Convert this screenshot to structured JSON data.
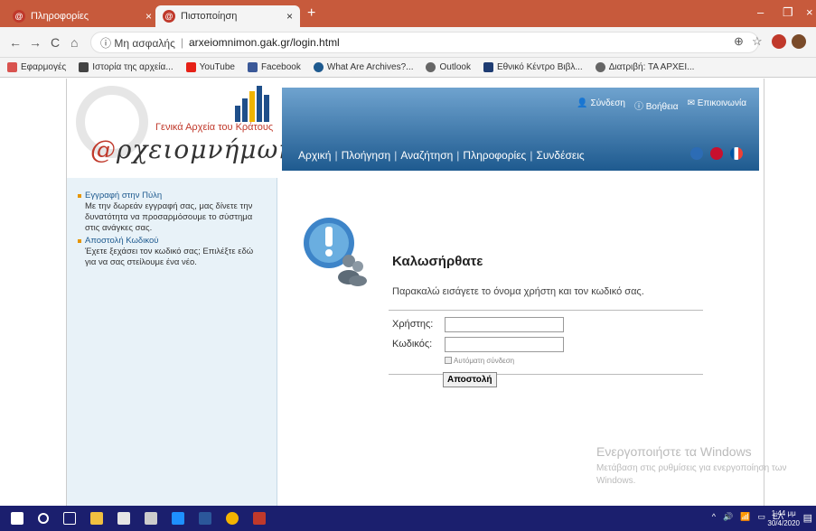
{
  "browser": {
    "tabs": [
      {
        "title": "Πληροφορίες",
        "active": false
      },
      {
        "title": "Πιστοποίηση",
        "active": true
      }
    ],
    "new_tab": "+",
    "address": {
      "security": "ⓘ Μη ασφαλής",
      "url": "arxeiomnimon.gak.gr/login.html"
    },
    "bookmarks": [
      {
        "label": "Εφαρμογές",
        "color": "#d9534f"
      },
      {
        "label": "Ιστορία της αρχεία...",
        "color": "#444"
      },
      {
        "label": "YouTube",
        "color": "#e62117"
      },
      {
        "label": "Facebook",
        "color": "#3b5998"
      },
      {
        "label": "What Are Archives?...",
        "color": "#1e5a8f"
      },
      {
        "label": "Outlook",
        "color": "#666"
      },
      {
        "label": "Εθνικό Κέντρο Βιβλ...",
        "color": "#1e3c72"
      },
      {
        "label": "Διατριβή: ΤΑ ΑΡΧΕΙ...",
        "color": "#666"
      }
    ]
  },
  "site": {
    "org_name": "Γενικά Αρχεία του Κράτους",
    "logo_prefix": "@",
    "logo_text": "ρχειομνήμων",
    "top_links": [
      {
        "label": "Σύνδεση"
      },
      {
        "label": "Βοήθεια"
      },
      {
        "label": "Επικοινωνία"
      }
    ],
    "menu": [
      "Αρχική",
      "Πλοήγηση",
      "Αναζήτηση",
      "Πληροφορίες",
      "Συνδέσεις"
    ],
    "menu_sep": "|",
    "sidebar": [
      {
        "title": "Εγγραφή στην Πύλη",
        "desc": "Με την δωρεάν εγγραφή σας, μας δίνετε την δυνατότητα να προσαρμόσουμε το σύστημα στις ανάγκες σας."
      },
      {
        "title": "Αποστολή Κωδικού",
        "desc": "Έχετε ξεχάσει τον κωδικό σας; Επιλέξτε εδώ για να σας στείλουμε ένα νέο."
      }
    ]
  },
  "login": {
    "welcome": "Καλωσήρθατε",
    "prompt": "Παρακαλώ εισάγετε το όνομα χρήστη και τον κωδικό σας.",
    "username_label": "Χρήστης:",
    "password_label": "Κωδικός:",
    "auto_login": "Αυτόματη σύνδεση",
    "submit": "Αποστολή",
    "username_value": "",
    "password_value": ""
  },
  "watermark": {
    "line1": "Ενεργοποιήστε τα Windows",
    "line2": "Μετάβαση στις ρυθμίσεις για ενεργοποίηση των Windows."
  },
  "taskbar": {
    "lang": "ΕΛ",
    "time": "1:44 μμ",
    "date": "30/4/2020"
  },
  "colors": {
    "titlebar": "#c75a3c",
    "banner_top": "#6fa3cf",
    "banner_bottom": "#1e5a8f",
    "taskbar": "#1b1f6e",
    "accent_red": "#c0392b"
  }
}
